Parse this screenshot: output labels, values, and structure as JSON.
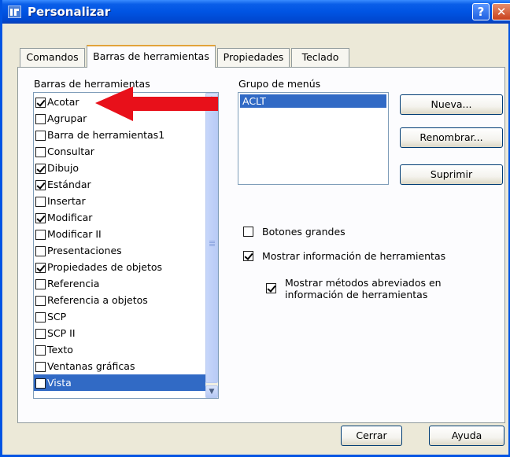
{
  "window": {
    "title": "Personalizar",
    "help_label": "?",
    "close_label": "✕"
  },
  "tabs": [
    {
      "label": "Comandos",
      "active": false
    },
    {
      "label": "Barras de herramientas",
      "active": true
    },
    {
      "label": "Propiedades",
      "active": false
    },
    {
      "label": "Teclado",
      "active": false
    }
  ],
  "toolbars": {
    "label": "Barras de herramientas",
    "items": [
      {
        "label": "Acotar",
        "checked": true,
        "selected": false
      },
      {
        "label": "Agrupar",
        "checked": false,
        "selected": false
      },
      {
        "label": "Barra de herramientas1",
        "checked": false,
        "selected": false
      },
      {
        "label": "Consultar",
        "checked": false,
        "selected": false
      },
      {
        "label": "Dibujo",
        "checked": true,
        "selected": false
      },
      {
        "label": "Estándar",
        "checked": true,
        "selected": false
      },
      {
        "label": "Insertar",
        "checked": false,
        "selected": false
      },
      {
        "label": "Modificar",
        "checked": true,
        "selected": false
      },
      {
        "label": "Modificar II",
        "checked": false,
        "selected": false
      },
      {
        "label": "Presentaciones",
        "checked": false,
        "selected": false
      },
      {
        "label": "Propiedades de objetos",
        "checked": true,
        "selected": false
      },
      {
        "label": "Referencia",
        "checked": false,
        "selected": false
      },
      {
        "label": "Referencia a objetos",
        "checked": false,
        "selected": false
      },
      {
        "label": "SCP",
        "checked": false,
        "selected": false
      },
      {
        "label": "SCP II",
        "checked": false,
        "selected": false
      },
      {
        "label": "Texto",
        "checked": false,
        "selected": false
      },
      {
        "label": "Ventanas gráficas",
        "checked": false,
        "selected": false
      },
      {
        "label": "Vista",
        "checked": false,
        "selected": true
      }
    ]
  },
  "menu_group": {
    "label": "Grupo de menús",
    "items": [
      "ACLT"
    ]
  },
  "buttons": {
    "new": "Nueva...",
    "rename": "Renombrar...",
    "delete": "Suprimir",
    "close": "Cerrar",
    "help": "Ayuda"
  },
  "options": {
    "large_buttons": {
      "label": "Botones grandes",
      "checked": false
    },
    "show_tooltips": {
      "label": "Mostrar información de herramientas",
      "checked": true
    },
    "show_shortcuts": {
      "line1": "Mostrar métodos abreviados en",
      "line2": "información de herramientas",
      "checked": true
    }
  },
  "annotation": {
    "color": "#e8101a"
  }
}
